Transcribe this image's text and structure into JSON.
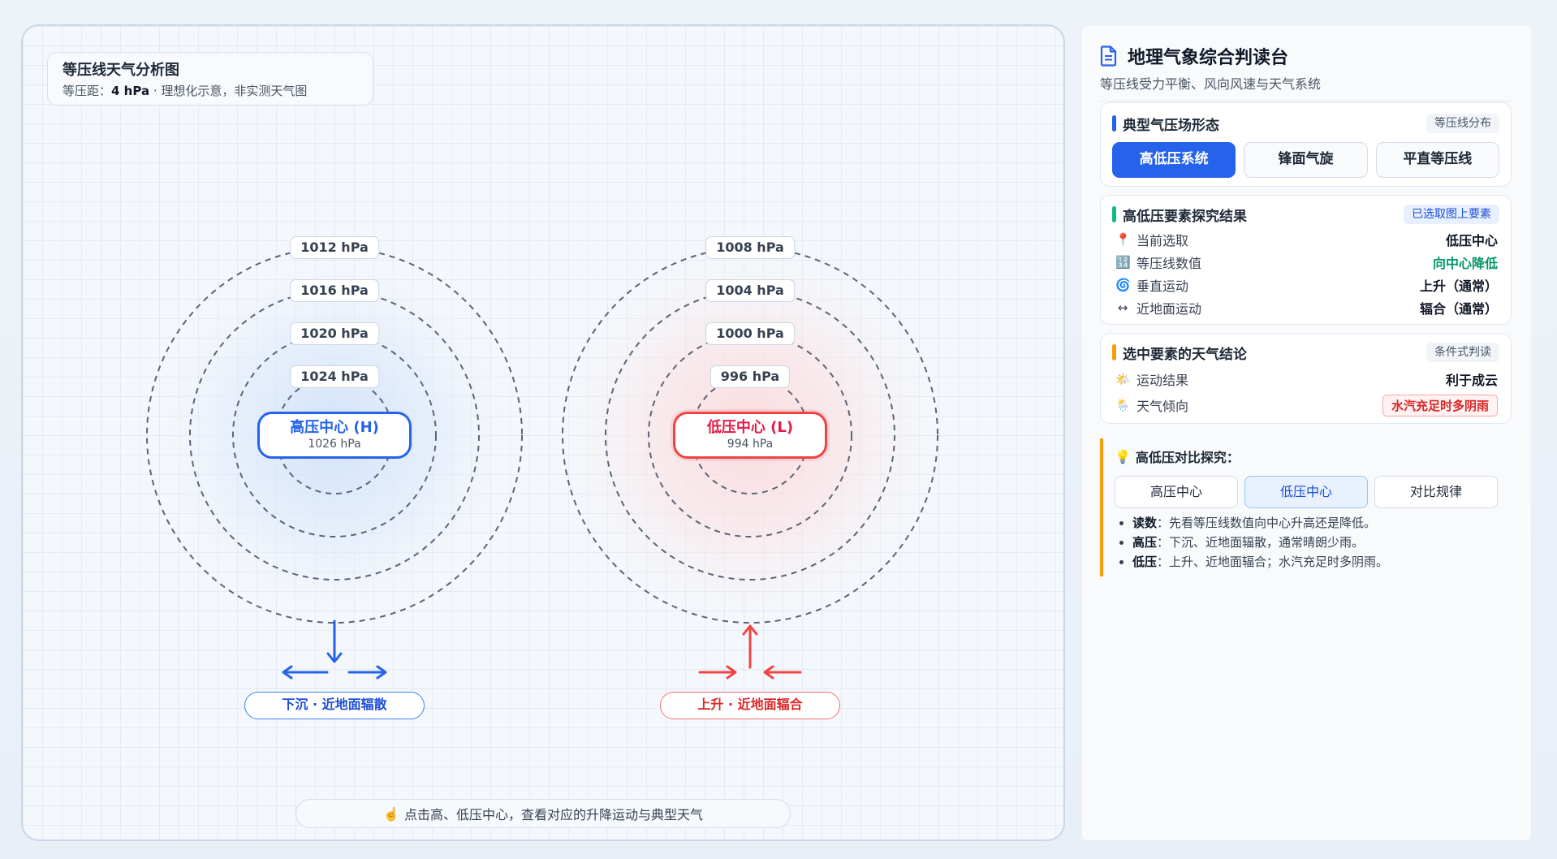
{
  "map": {
    "title": "等压线天气分析图",
    "subtitle_prefix": "等压距：",
    "subtitle_value": "4 hPa",
    "subtitle_suffix": " · 理想化示意，非实测天气图",
    "hint_icon": "☝️",
    "hint": "点击高、低压中心，查看对应的升降运动与典型天气",
    "high": {
      "isobars": [
        "1012 hPa",
        "1016 hPa",
        "1020 hPa",
        "1024 hPa"
      ],
      "center_title": "高压中心 (H)",
      "center_value": "1026 hPa",
      "motion": "下沉 · 近地面辐散"
    },
    "low": {
      "isobars": [
        "1008 hPa",
        "1004 hPa",
        "1000 hPa",
        "996 hPa"
      ],
      "center_title": "低压中心 (L)",
      "center_value": "994 hPa",
      "motion": "上升 · 近地面辐合"
    },
    "colors": {
      "high": "#2563eb",
      "low": "#ef4444",
      "isobar": "#5b6478"
    }
  },
  "side": {
    "title": "地理气象综合判读台",
    "subtitle": "等压线受力平衡、风向风速与天气系统",
    "pattern_card": {
      "title": "典型气压场形态",
      "tag": "等压线分布",
      "buttons": [
        "高低压系统",
        "锋面气旋",
        "平直等压线"
      ],
      "active_index": 0
    },
    "result_card": {
      "title": "高低压要素探究结果",
      "tag": "已选取图上要素",
      "rows": [
        {
          "icon": "📍",
          "icon_name": "pin-icon",
          "label": "当前选取",
          "value": "低压中心"
        },
        {
          "icon": "🔢",
          "icon_name": "numbers-icon",
          "label": "等压线数值",
          "value": "向中心降低"
        },
        {
          "icon": "🌀",
          "icon_name": "cyclone-icon",
          "label": "垂直运动",
          "value": "上升（通常）"
        },
        {
          "icon": "↔",
          "icon_name": "left-right-arrow-icon",
          "label": "近地面运动",
          "value": "辐合（通常）"
        }
      ]
    },
    "weather_card": {
      "title": "选中要素的天气结论",
      "tag": "条件式判读",
      "rows": [
        {
          "icon": "🌤️",
          "icon_name": "sun-cloud-icon",
          "label": "运动结果",
          "value": "利于成云"
        },
        {
          "icon": "🌦️",
          "icon_name": "sun-rain-icon",
          "label": "天气倾向",
          "value": "水汽充足时多阴雨"
        }
      ]
    },
    "explore": {
      "icon": "💡",
      "title": "高低压对比探究：",
      "buttons": [
        "高压中心",
        "低压中心",
        "对比规律"
      ],
      "active_index": 1,
      "items": [
        {
          "term": "读数",
          "text": "：先看等压线数值向中心升高还是降低。"
        },
        {
          "term": "高压",
          "text": "：下沉、近地面辐散，通常晴朗少雨。"
        },
        {
          "term": "低压",
          "text": "：上升、近地面辐合；水汽充足时多阴雨。"
        }
      ]
    },
    "colors": {
      "accent": "#2563eb",
      "bar_blue": "#2563eb",
      "bar_green": "#10b981",
      "bar_orange": "#f59e0b",
      "explore_border": "#f59e0b"
    }
  }
}
